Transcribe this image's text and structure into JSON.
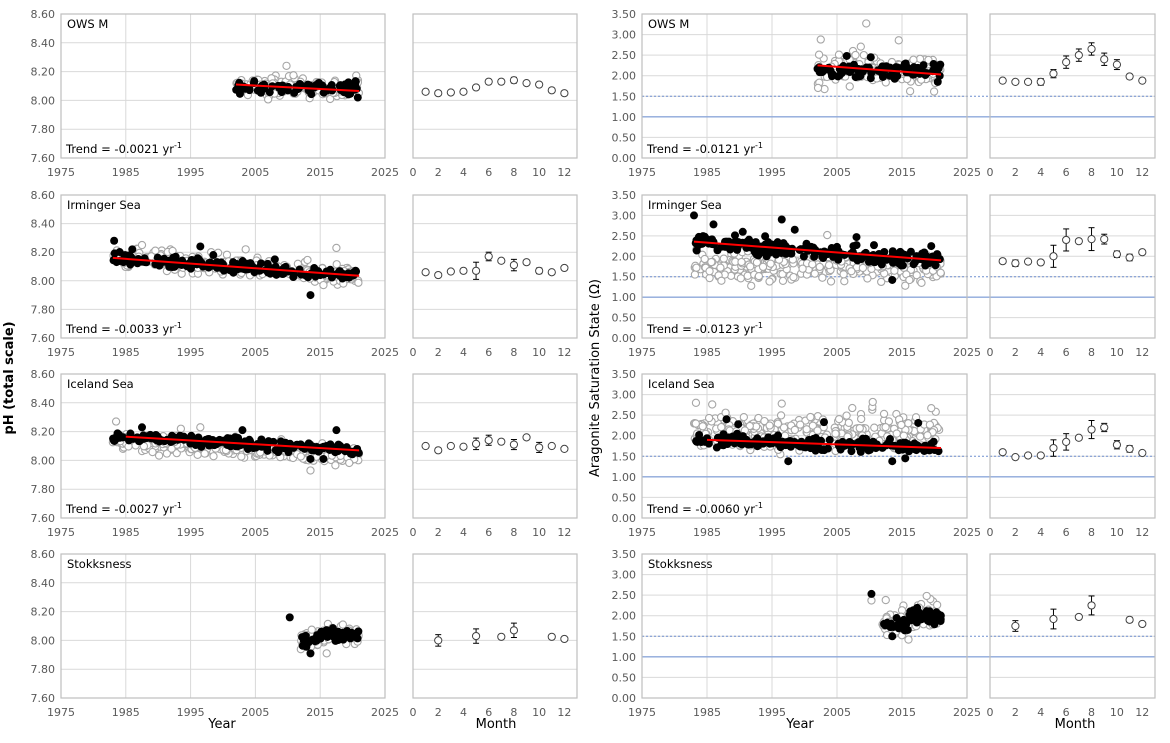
{
  "figure": {
    "ylabel_left": "pH (total scale)",
    "ylabel_right": "Aragonite Saturation State (Ω)",
    "xlabel_year": "Year",
    "xlabel_month": "Month"
  },
  "chart_data": [
    {
      "id": "ph-owsm-year",
      "type": "scatter",
      "title": "OWS M",
      "variable": "pH",
      "xlabel": "",
      "ylabel": "pH (total scale)",
      "xlim": [
        1975,
        2025
      ],
      "ylim": [
        7.6,
        8.6
      ],
      "xticks": [
        "1975",
        "1985",
        "1995",
        "2005",
        "2015",
        "2025"
      ],
      "yticks": [
        "7.60",
        "7.80",
        "8.00",
        "8.20",
        "8.40",
        "8.60"
      ],
      "grid": true,
      "trend_label": "Trend = -0.0021 yr",
      "trend_sup": "-1",
      "trend_line": {
        "x": [
          2002,
          2021
        ],
        "y": [
          8.11,
          8.065
        ]
      },
      "cloud": {
        "x0": 2002,
        "x1": 2021,
        "filled_center": 8.09,
        "filled_spread": 0.035,
        "open_center": 8.09,
        "open_spread": 0.06,
        "n": 120
      },
      "outliers_open": [
        [
          2009.8,
          8.24
        ]
      ],
      "outliers_filled": [
        [
          2020.5,
          8.13
        ],
        [
          2020.8,
          8.02
        ]
      ]
    },
    {
      "id": "ph-owsm-month",
      "type": "scatter",
      "title": "",
      "variable": "pH",
      "xlim": [
        0,
        13
      ],
      "ylim": [
        7.6,
        8.6
      ],
      "xticks": [
        "0",
        "2",
        "4",
        "6",
        "8",
        "10",
        "12"
      ],
      "grid": true,
      "x": [
        1,
        2,
        3,
        4,
        5,
        6,
        7,
        8,
        9,
        10,
        11,
        12
      ],
      "y": [
        8.06,
        8.05,
        8.055,
        8.06,
        8.09,
        8.13,
        8.13,
        8.14,
        8.12,
        8.11,
        8.07,
        8.05
      ],
      "err": [
        0,
        0,
        0,
        0.015,
        0.01,
        0.015,
        0.015,
        0.02,
        0.015,
        0.01,
        0.01,
        0.012
      ]
    },
    {
      "id": "omega-owsm-year",
      "type": "scatter",
      "title": "OWS M",
      "variable": "omega",
      "xlim": [
        1975,
        2025
      ],
      "ylim": [
        0,
        3.5
      ],
      "xticks": [
        "1975",
        "1985",
        "1995",
        "2005",
        "2015",
        "2025"
      ],
      "yticks": [
        "0.00",
        "0.50",
        "1.00",
        "1.50",
        "2.00",
        "2.50",
        "3.00",
        "3.50"
      ],
      "grid": true,
      "ref_lines": {
        "solid": 1.0,
        "dashed": 1.5
      },
      "trend_label": "Trend = -0.0121 yr",
      "trend_sup": "-1",
      "trend_line": {
        "x": [
          2002,
          2021
        ],
        "y": [
          2.25,
          2.03
        ]
      },
      "cloud": {
        "x0": 2002,
        "x1": 2021,
        "filled_center": 2.12,
        "filled_spread": 0.15,
        "open_center": 2.15,
        "open_spread": 0.35,
        "n": 130
      },
      "outliers_open": [
        [
          2009.5,
          3.27
        ],
        [
          2002.5,
          2.88
        ],
        [
          2014.5,
          2.86
        ]
      ],
      "outliers_filled": [
        [
          2006.5,
          2.48
        ],
        [
          2010.2,
          2.45
        ],
        [
          2020.5,
          1.85
        ]
      ]
    },
    {
      "id": "omega-owsm-month",
      "type": "scatter",
      "title": "",
      "variable": "omega",
      "xlim": [
        0,
        13
      ],
      "ylim": [
        0,
        3.5
      ],
      "xticks": [
        "0",
        "2",
        "4",
        "6",
        "8",
        "10",
        "12"
      ],
      "grid": true,
      "ref_lines": {
        "solid": 1.0,
        "dashed": 1.5
      },
      "x": [
        1,
        2,
        3,
        4,
        5,
        6,
        7,
        8,
        9,
        10,
        11,
        12
      ],
      "y": [
        1.88,
        1.85,
        1.85,
        1.85,
        2.05,
        2.33,
        2.5,
        2.65,
        2.4,
        2.27,
        1.98,
        1.88
      ],
      "err": [
        0,
        0,
        0,
        0.08,
        0.1,
        0.15,
        0.15,
        0.15,
        0.15,
        0.12,
        0.06,
        0.04
      ]
    },
    {
      "id": "ph-irminger-year",
      "type": "scatter",
      "title": "Irminger Sea",
      "variable": "pH",
      "xlim": [
        1975,
        2025
      ],
      "ylim": [
        7.6,
        8.6
      ],
      "xticks": [
        "1975",
        "1985",
        "1995",
        "2005",
        "2015",
        "2025"
      ],
      "yticks": [
        "7.60",
        "7.80",
        "8.00",
        "8.20",
        "8.40",
        "8.60"
      ],
      "grid": true,
      "trend_label": "Trend = -0.0033 yr",
      "trend_sup": "-1",
      "trend_line": {
        "x": [
          1983,
          2021
        ],
        "y": [
          8.16,
          8.035
        ]
      },
      "cloud": {
        "x0": 1983,
        "x1": 2021,
        "filled_center": "trend",
        "filled_spread": 0.03,
        "open_center": "trend",
        "open_spread": 0.06,
        "n": 260
      },
      "outliers_open": [
        [
          1987.5,
          8.25
        ],
        [
          2003.5,
          8.22
        ],
        [
          2017.5,
          8.23
        ],
        [
          2015.5,
          7.97
        ]
      ],
      "outliers_filled": [
        [
          1983.2,
          8.28
        ],
        [
          1986,
          8.22
        ],
        [
          1996.5,
          8.24
        ],
        [
          1998.5,
          8.18
        ],
        [
          2008,
          8.15
        ],
        [
          2013.5,
          7.9
        ]
      ]
    },
    {
      "id": "ph-irminger-month",
      "type": "scatter",
      "title": "",
      "variable": "pH",
      "xlim": [
        0,
        13
      ],
      "ylim": [
        7.6,
        8.6
      ],
      "xticks": [
        "0",
        "2",
        "4",
        "6",
        "8",
        "10",
        "12"
      ],
      "grid": true,
      "x": [
        1,
        2,
        3,
        4,
        5,
        6,
        7,
        8,
        9,
        10,
        11,
        12
      ],
      "y": [
        8.06,
        8.04,
        8.065,
        8.07,
        8.07,
        8.17,
        8.14,
        8.11,
        8.13,
        8.07,
        8.06,
        8.09
      ],
      "err": [
        0,
        0.015,
        0,
        0,
        0.06,
        0.03,
        0,
        0.04,
        0.015,
        0.02,
        0.01,
        0
      ]
    },
    {
      "id": "omega-irminger-year",
      "type": "scatter",
      "title": "Irminger Sea",
      "variable": "omega",
      "xlim": [
        1975,
        2025
      ],
      "ylim": [
        0,
        3.5
      ],
      "xticks": [
        "1975",
        "1985",
        "1995",
        "2005",
        "2015",
        "2025"
      ],
      "yticks": [
        "0.00",
        "0.50",
        "1.00",
        "1.50",
        "2.00",
        "2.50",
        "3.00",
        "3.50"
      ],
      "grid": true,
      "ref_lines": {
        "solid": 1.0,
        "dashed": 1.5
      },
      "trend_label": "Trend = -0.0123 yr",
      "trend_sup": "-1",
      "trend_line": {
        "x": [
          1983,
          2021
        ],
        "y": [
          2.36,
          1.9
        ]
      },
      "cloud": {
        "x0": 1983,
        "x1": 2021,
        "filled_center": "trend",
        "filled_spread": 0.15,
        "open_center": 1.75,
        "open_spread": 0.3,
        "n": 300
      },
      "outliers_open": [
        [
          2003.5,
          2.52
        ],
        [
          2015.5,
          1.28
        ],
        [
          2018,
          1.35
        ]
      ],
      "outliers_filled": [
        [
          1983,
          3.0
        ],
        [
          1986,
          2.78
        ],
        [
          1996.5,
          2.9
        ],
        [
          1990.5,
          2.6
        ],
        [
          1998.5,
          2.65
        ],
        [
          2008,
          2.47
        ],
        [
          2013.5,
          1.42
        ],
        [
          2019.5,
          2.25
        ]
      ]
    },
    {
      "id": "omega-irminger-month",
      "type": "scatter",
      "title": "",
      "variable": "omega",
      "xlim": [
        0,
        13
      ],
      "ylim": [
        0,
        3.5
      ],
      "xticks": [
        "0",
        "2",
        "4",
        "6",
        "8",
        "10",
        "12"
      ],
      "grid": true,
      "ref_lines": {
        "solid": 1.0,
        "dashed": 1.5
      },
      "x": [
        1,
        2,
        3,
        4,
        5,
        6,
        7,
        8,
        9,
        10,
        11,
        12
      ],
      "y": [
        1.88,
        1.83,
        1.87,
        1.85,
        2.0,
        2.4,
        2.37,
        2.42,
        2.42,
        2.05,
        1.97,
        2.1
      ],
      "err": [
        0,
        0.08,
        0,
        0,
        0.27,
        0.27,
        0,
        0.28,
        0.12,
        0.08,
        0.08,
        0
      ]
    },
    {
      "id": "ph-iceland-year",
      "type": "scatter",
      "title": "Iceland Sea",
      "variable": "pH",
      "xlim": [
        1975,
        2025
      ],
      "ylim": [
        7.6,
        8.6
      ],
      "xticks": [
        "1975",
        "1985",
        "1995",
        "2005",
        "2015",
        "2025"
      ],
      "yticks": [
        "7.60",
        "7.80",
        "8.00",
        "8.20",
        "8.40",
        "8.60"
      ],
      "grid": true,
      "trend_label": "Trend = -0.0027 yr",
      "trend_sup": "-1",
      "trend_line": {
        "x": [
          1985,
          2021
        ],
        "y": [
          8.165,
          8.07
        ]
      },
      "cloud": {
        "x0": 1983,
        "x1": 2021,
        "filled_center": "trend",
        "filled_spread": 0.03,
        "open_center": "trend-0.04",
        "open_spread": 0.05,
        "n": 300
      },
      "outliers_open": [
        [
          1983.5,
          8.27
        ],
        [
          1996.5,
          8.23
        ],
        [
          1993.5,
          8.22
        ],
        [
          2013.5,
          7.93
        ]
      ],
      "outliers_filled": [
        [
          1987.5,
          8.23
        ],
        [
          2003,
          8.21
        ],
        [
          2017.5,
          8.21
        ],
        [
          2013.5,
          8.01
        ],
        [
          2015.5,
          8.01
        ]
      ]
    },
    {
      "id": "ph-iceland-month",
      "type": "scatter",
      "title": "",
      "variable": "pH",
      "xlim": [
        0,
        13
      ],
      "ylim": [
        7.6,
        8.6
      ],
      "xticks": [
        "0",
        "2",
        "4",
        "6",
        "8",
        "10",
        "12"
      ],
      "grid": true,
      "x": [
        1,
        2,
        3,
        4,
        5,
        6,
        7,
        8,
        9,
        10,
        11,
        12
      ],
      "y": [
        8.1,
        8.07,
        8.1,
        8.095,
        8.115,
        8.14,
        8.13,
        8.11,
        8.16,
        8.09,
        8.1,
        8.08
      ],
      "err": [
        0,
        0.015,
        0,
        0,
        0.04,
        0.035,
        0,
        0.035,
        0,
        0.035,
        0.01,
        0
      ]
    },
    {
      "id": "omega-iceland-year",
      "type": "scatter",
      "title": "Iceland Sea",
      "variable": "omega",
      "xlim": [
        1975,
        2025
      ],
      "ylim": [
        0,
        3.5
      ],
      "xticks": [
        "1975",
        "1985",
        "1995",
        "2005",
        "2015",
        "2025"
      ],
      "yticks": [
        "0.00",
        "0.50",
        "1.00",
        "1.50",
        "2.00",
        "2.50",
        "3.00",
        "3.50"
      ],
      "grid": true,
      "ref_lines": {
        "solid": 1.0,
        "dashed": 1.5
      },
      "trend_label": "Trend = -0.0060 yr",
      "trend_sup": "-1",
      "trend_line": {
        "x": [
          1985,
          2021
        ],
        "y": [
          1.9,
          1.7
        ]
      },
      "cloud": {
        "x0": 1983,
        "x1": 2021,
        "filled_center": "trend",
        "filled_spread": 0.13,
        "open_center": 2.1,
        "open_spread": 0.35,
        "n": 320
      },
      "outliers_open": [
        [
          1983.3,
          2.8
        ],
        [
          1985.8,
          2.76
        ],
        [
          2010.5,
          2.82
        ],
        [
          2019.5,
          2.67
        ],
        [
          1996.5,
          2.78
        ]
      ],
      "outliers_filled": [
        [
          1988,
          2.4
        ],
        [
          1989.8,
          2.28
        ],
        [
          1997.5,
          1.38
        ],
        [
          2003,
          2.33
        ],
        [
          2017.5,
          2.31
        ],
        [
          2013.5,
          1.38
        ],
        [
          2015.5,
          1.45
        ]
      ]
    },
    {
      "id": "omega-iceland-month",
      "type": "scatter",
      "title": "",
      "variable": "omega",
      "xlim": [
        0,
        13
      ],
      "ylim": [
        0,
        3.5
      ],
      "xticks": [
        "0",
        "2",
        "4",
        "6",
        "8",
        "10",
        "12"
      ],
      "grid": true,
      "ref_lines": {
        "solid": 1.0,
        "dashed": 1.5
      },
      "x": [
        1,
        2,
        3,
        4,
        5,
        6,
        7,
        8,
        9,
        10,
        11,
        12
      ],
      "y": [
        1.6,
        1.48,
        1.52,
        1.52,
        1.7,
        1.85,
        1.95,
        2.15,
        2.2,
        1.78,
        1.68,
        1.58
      ],
      "err": [
        0,
        0.05,
        0,
        0,
        0.2,
        0.2,
        0,
        0.22,
        0.1,
        0.1,
        0.08,
        0
      ]
    },
    {
      "id": "ph-stokksness-year",
      "type": "scatter",
      "title": "Stokksness",
      "variable": "pH",
      "xlim": [
        1975,
        2025
      ],
      "ylim": [
        7.6,
        8.6
      ],
      "xticks": [
        "1975",
        "1985",
        "1995",
        "2005",
        "2015",
        "2025"
      ],
      "yticks": [
        "7.60",
        "7.80",
        "8.00",
        "8.20",
        "8.40",
        "8.60"
      ],
      "grid": true,
      "cloud": {
        "x0": 2012,
        "x1": 2021,
        "filled_center": "stok",
        "filled_spread": 0.035,
        "open_center": "stok",
        "open_spread": 0.05,
        "n": 90
      },
      "outliers_open": [
        [
          2016,
          7.91
        ],
        [
          2018.5,
          8.11
        ]
      ],
      "outliers_filled": [
        [
          2010.3,
          8.16
        ],
        [
          2013.5,
          7.91
        ]
      ]
    },
    {
      "id": "ph-stokksness-month",
      "type": "scatter",
      "title": "",
      "variable": "pH",
      "xlim": [
        0,
        13
      ],
      "ylim": [
        7.6,
        8.6
      ],
      "xticks": [
        "0",
        "2",
        "4",
        "6",
        "8",
        "10",
        "12"
      ],
      "grid": true,
      "x": [
        2,
        5,
        7,
        8,
        11,
        12
      ],
      "y": [
        8.0,
        8.03,
        8.025,
        8.07,
        8.025,
        8.01
      ],
      "err": [
        0.04,
        0.05,
        0,
        0.05,
        0,
        0
      ]
    },
    {
      "id": "omega-stokksness-year",
      "type": "scatter",
      "title": "Stokksness",
      "variable": "omega",
      "xlim": [
        1975,
        2025
      ],
      "ylim": [
        0,
        3.5
      ],
      "xticks": [
        "1975",
        "1985",
        "1995",
        "2005",
        "2015",
        "2025"
      ],
      "yticks": [
        "0.00",
        "0.50",
        "1.00",
        "1.50",
        "2.00",
        "2.50",
        "3.00",
        "3.50"
      ],
      "grid": true,
      "ref_lines": {
        "solid": 1.0,
        "dashed": 1.5
      },
      "cloud": {
        "x0": 2012,
        "x1": 2021,
        "filled_center": "stokO",
        "filled_spread": 0.15,
        "open_center": "stokO",
        "open_spread": 0.25,
        "n": 100
      },
      "outliers_open": [
        [
          2010.3,
          2.37
        ],
        [
          2012.5,
          2.38
        ],
        [
          2018.8,
          2.48
        ],
        [
          2016,
          1.42
        ]
      ],
      "outliers_filled": [
        [
          2010.3,
          2.53
        ],
        [
          2013.5,
          1.5
        ]
      ]
    },
    {
      "id": "omega-stokksness-month",
      "type": "scatter",
      "title": "",
      "variable": "omega",
      "xlim": [
        0,
        13
      ],
      "ylim": [
        0,
        3.5
      ],
      "xticks": [
        "0",
        "2",
        "4",
        "6",
        "8",
        "10",
        "12"
      ],
      "grid": true,
      "ref_lines": {
        "solid": 1.0,
        "dashed": 1.5
      },
      "x": [
        2,
        5,
        7,
        8,
        11,
        12
      ],
      "y": [
        1.75,
        1.92,
        1.97,
        2.25,
        1.9,
        1.8
      ],
      "err": [
        0.13,
        0.24,
        0,
        0.23,
        0.06,
        0
      ]
    }
  ]
}
